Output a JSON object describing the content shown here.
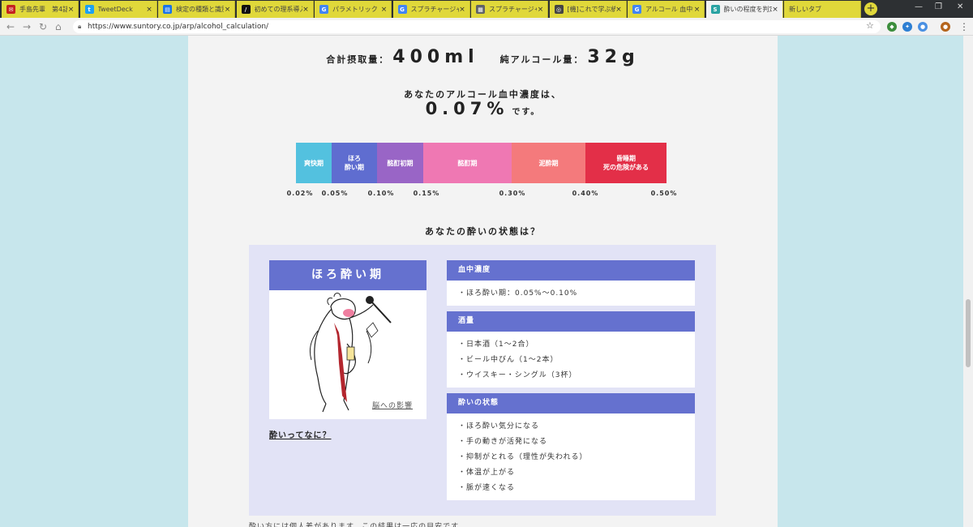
{
  "browser": {
    "tabs": [
      {
        "title": "手島先輩　第4話",
        "icon": "mail-icon",
        "color": "#c5221f",
        "glyph": "✉"
      },
      {
        "title": "TweetDeck",
        "icon": "tweetdeck-icon",
        "color": "#1da1f2",
        "glyph": "t"
      },
      {
        "title": "検定の種類と識別",
        "icon": "document-icon",
        "color": "#1a73e8",
        "glyph": "▤"
      },
      {
        "title": "初めての理系導入",
        "icon": "book-icon",
        "color": "#111111",
        "glyph": "/"
      },
      {
        "title": "パラメトリック ノンパ",
        "icon": "google-icon",
        "color": "#4285f4",
        "glyph": "G"
      },
      {
        "title": "スプラチャージャー 乃",
        "icon": "google-icon",
        "color": "#4285f4",
        "glyph": "G"
      },
      {
        "title": "スプラチャージャー",
        "icon": "calendar-icon",
        "color": "#5f6368",
        "glyph": "▦"
      },
      {
        "title": "[機]これで学ぶ統計",
        "icon": "qiita-icon",
        "color": "#444444",
        "glyph": "◎"
      },
      {
        "title": "アルコール 血中濃",
        "icon": "google-icon",
        "color": "#4285f4",
        "glyph": "G"
      },
      {
        "title": "酔いの程度を判定",
        "icon": "suntory-icon",
        "color": "#2aa3a3",
        "glyph": "S",
        "active": true
      },
      {
        "title": "新しいタブ",
        "icon": "",
        "color": "",
        "glyph": ""
      }
    ],
    "url": "https://www.suntory.co.jp/arp/alcohol_calculation/"
  },
  "totals": {
    "intake_label": "合計摂取量：",
    "intake_value": "400ml",
    "pure_label": "純アルコール量：",
    "pure_value": "32g"
  },
  "bac": {
    "heading": "あなたのアルコール血中濃度は、",
    "value": "0.07%",
    "suffix": "です。"
  },
  "scale": {
    "segments": [
      {
        "label": "爽快期",
        "from": 0.02,
        "to": 0.05,
        "color": "#53c1df"
      },
      {
        "label": "ほろ\n酔い期",
        "from": 0.05,
        "to": 0.1,
        "color": "#5f6dd0",
        "current": true
      },
      {
        "label": "酩酊初期",
        "from": 0.1,
        "to": 0.15,
        "color": "#9965c6"
      },
      {
        "label": "酩酊期",
        "from": 0.15,
        "to": 0.3,
        "color": "#ef78b3"
      },
      {
        "label": "泥酔期",
        "from": 0.3,
        "to": 0.4,
        "color": "#f47a7c"
      },
      {
        "label": "昏睡期\n死の危険がある",
        "from": 0.4,
        "to": 0.5,
        "color": "#e32f48"
      }
    ],
    "ticks": [
      "0.02%",
      "0.05%",
      "0.10%",
      "0.15%",
      "0.30%",
      "0.40%",
      "0.50%"
    ],
    "tick_values": [
      0.02,
      0.05,
      0.1,
      0.15,
      0.3,
      0.4,
      0.5
    ]
  },
  "state": {
    "question": "あなたの酔いの状態は？",
    "stage_title": "ほろ酔い期",
    "brain_link": "脳への影響",
    "what_link": "酔いってなに？",
    "sections": [
      {
        "heading": "血中濃度",
        "items": [
          "・ほろ酔い期：0.05%～0.10%"
        ]
      },
      {
        "heading": "酒量",
        "items": [
          "・日本酒（1～2合）",
          "・ビール中びん（1～2本）",
          "・ウイスキー・シングル（3杯）"
        ]
      },
      {
        "heading": "酔いの状態",
        "items": [
          "・ほろ酔い気分になる",
          "・手の動きが活発になる",
          "・抑制がとれる（理性が失われる）",
          "・体温が上がる",
          "・脈が速くなる"
        ]
      }
    ]
  },
  "footer_note": "酔い方には個人差があります。この結果は一応の目安です。"
}
